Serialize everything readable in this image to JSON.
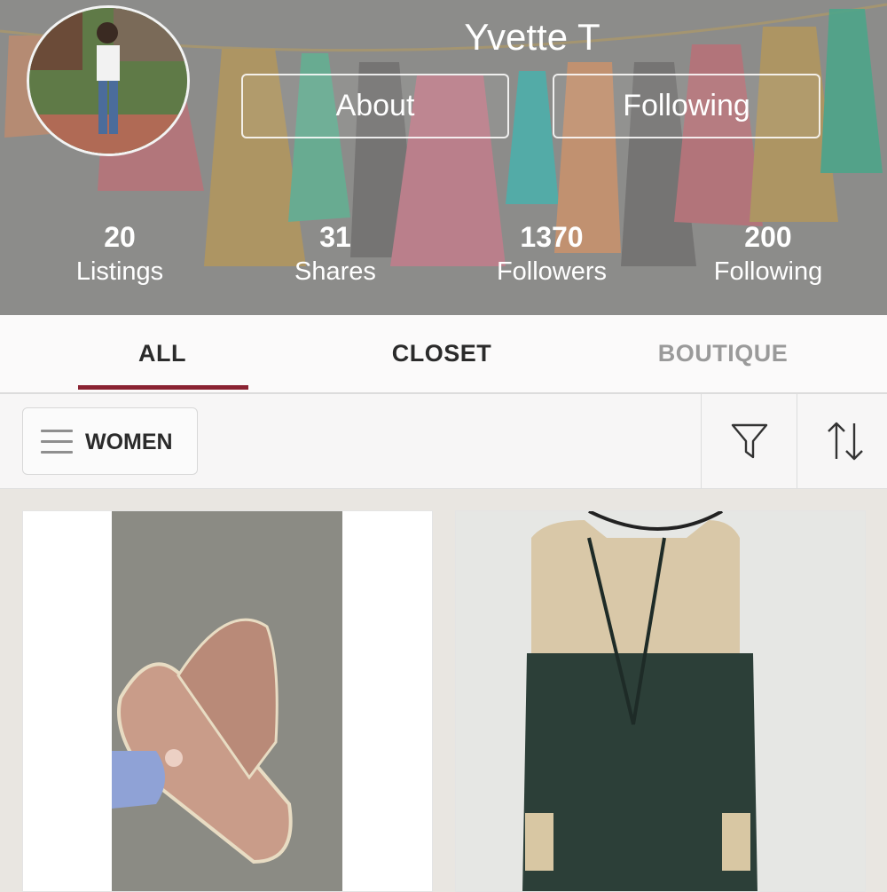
{
  "profile": {
    "name": "Yvette T",
    "about_label": "About",
    "following_label": "Following"
  },
  "stats": [
    {
      "value": "20",
      "label": "Listings"
    },
    {
      "value": "31",
      "label": "Shares"
    },
    {
      "value": "1370",
      "label": "Followers"
    },
    {
      "value": "200",
      "label": "Following"
    }
  ],
  "tabs": [
    {
      "label": "ALL",
      "active": true
    },
    {
      "label": "CLOSET",
      "active": false
    },
    {
      "label": "BOUTIQUE",
      "active": false
    }
  ],
  "filter_bar": {
    "category_label": "WOMEN"
  },
  "colors": {
    "accent": "#8a2332",
    "inactive_tab": "#9a9a9a"
  },
  "icons": [
    "hamburger-menu-icon",
    "filter-funnel-icon",
    "sort-arrows-icon"
  ]
}
